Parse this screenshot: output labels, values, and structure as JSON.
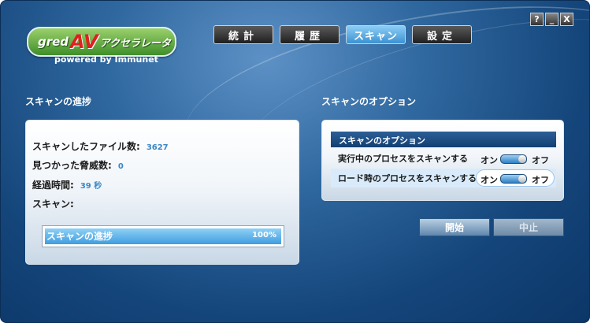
{
  "logo": {
    "brand": "gred",
    "av": "AV",
    "name": "アクセラレータ",
    "powered": "powered by Immunet"
  },
  "tabs": [
    {
      "label": "統計",
      "active": false
    },
    {
      "label": "履歴",
      "active": false
    },
    {
      "label": "スキャン",
      "active": true
    },
    {
      "label": "設定",
      "active": false
    }
  ],
  "window_controls": {
    "help": "?",
    "minimize": "_",
    "close": "X"
  },
  "progress_section": {
    "title": "スキャンの進捗",
    "scanned_label": "スキャンしたファイル数:",
    "scanned_value": "3627",
    "threats_label": "見つかった脅威数:",
    "threats_value": "0",
    "elapsed_label": "経過時間:",
    "elapsed_value": "39 秒",
    "scan_label": "スキャン:",
    "bar_label": "スキャンの進捗",
    "bar_percent": "100%",
    "bar_fraction": 1.0
  },
  "options_section": {
    "title": "スキャンのオプション",
    "header": "スキャンのオプション",
    "options": [
      {
        "label": "実行中のプロセスをスキャンする",
        "on": "オン",
        "off": "オフ",
        "state": "on",
        "highlighted": false
      },
      {
        "label": "ロード時のプロセスをスキャンする",
        "on": "オン",
        "off": "オフ",
        "state": "on",
        "highlighted": true
      }
    ]
  },
  "actions": {
    "start": "開始",
    "stop": "中止"
  },
  "colors": {
    "background": "#1f5288",
    "accent": "#3c92d2",
    "value_text": "#3a87c6"
  }
}
